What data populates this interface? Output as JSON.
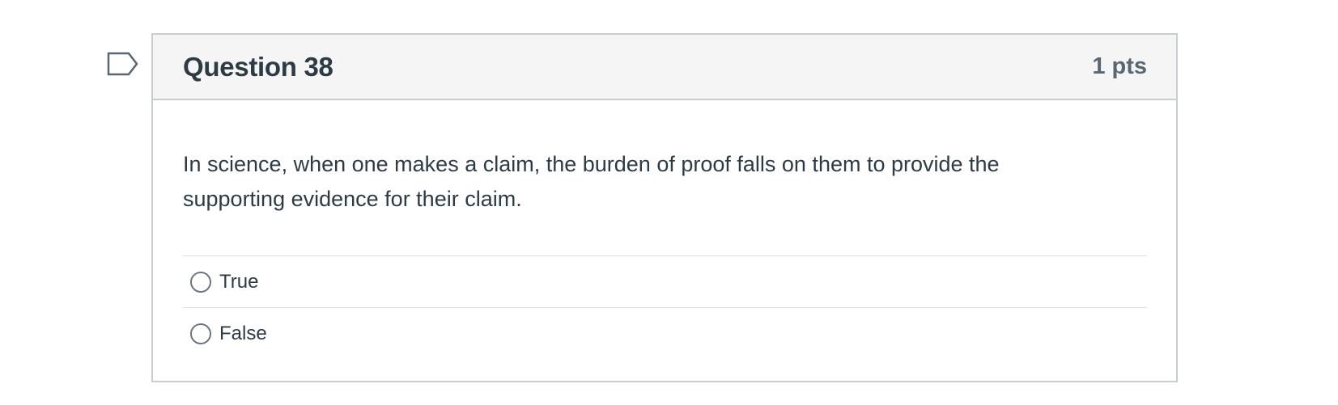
{
  "flag": {
    "icon": "flag-outline-icon",
    "color": "#5a6670"
  },
  "question": {
    "title": "Question 38",
    "points": "1 pts",
    "text": "In science, when one makes a claim, the burden of proof falls on them to provide the supporting evidence for their claim.",
    "answers": [
      {
        "label": "True",
        "selected": false
      },
      {
        "label": "False",
        "selected": false
      }
    ]
  },
  "colors": {
    "text": "#2d3b45",
    "header_bg": "#f5f5f5",
    "border": "#c7cdd1",
    "points": "#5a6670"
  }
}
